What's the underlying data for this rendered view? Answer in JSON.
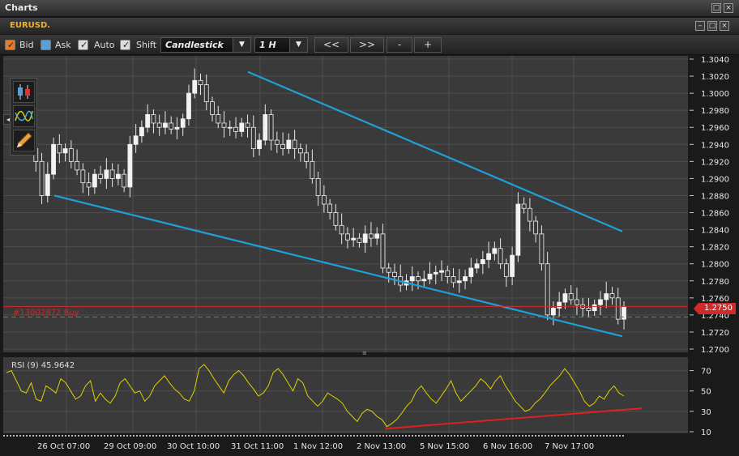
{
  "window": {
    "title": "Charts"
  },
  "chart_window": {
    "title": "EURUSD."
  },
  "toolbar": {
    "bid_label": "Bid",
    "ask_label": "Ask",
    "auto_label": "Auto",
    "shift_label": "Shift",
    "chart_type": "Candlestick",
    "timeframe": "1 H",
    "prev_label": "<<",
    "next_label": ">>",
    "zoom_out_label": "-",
    "zoom_in_label": "+"
  },
  "order_line": {
    "label": "#13002872 Buy",
    "price_badge": "1.2750"
  },
  "rsi": {
    "label": "RSI (9)  45.9642"
  },
  "colors": {
    "trendline": "#1fa0d8",
    "rsi_line": "#e0d000",
    "rsi_trend": "#e02020",
    "order_line": "#d22a2a"
  },
  "icons": [
    "checkbox-icon",
    "candlestick-tool-icon",
    "indicator-tool-icon",
    "pencil-tool-icon",
    "collapse-arrow-icon"
  ],
  "chart_data": [
    {
      "type": "candlestick",
      "title": "EURUSD.",
      "y_ticks": [
        "1.3040",
        "1.3020",
        "1.3000",
        "1.2980",
        "1.2960",
        "1.2940",
        "1.2920",
        "1.2900",
        "1.2880",
        "1.2860",
        "1.2840",
        "1.2820",
        "1.2800",
        "1.2780",
        "1.2760",
        "1.2740",
        "1.2720",
        "1.2700"
      ],
      "ylim": [
        1.27,
        1.304
      ],
      "x_labels": [
        "26 Oct 07:00",
        "29 Oct 09:00",
        "30 Oct 10:00",
        "31 Oct 11:00",
        "1 Nov 12:00",
        "2 Nov 13:00",
        "5 Nov 15:00",
        "6 Nov 16:00",
        "7 Nov 17:00"
      ],
      "close_path": [
        1.2945,
        1.2942,
        1.2938,
        1.295,
        1.2935,
        1.292,
        1.288,
        1.2905,
        1.294,
        1.293,
        1.2935,
        1.292,
        1.291,
        1.2895,
        1.289,
        1.2905,
        1.29,
        1.291,
        1.29,
        1.2905,
        1.289,
        1.294,
        1.295,
        1.296,
        1.2975,
        1.2965,
        1.296,
        1.2965,
        1.2958,
        1.296,
        1.297,
        1.3,
        1.3015,
        1.301,
        1.299,
        1.2975,
        1.2965,
        1.296,
        1.296,
        1.2955,
        1.2965,
        1.296,
        1.2935,
        1.2945,
        1.2975,
        1.2945,
        1.294,
        1.2935,
        1.2945,
        1.2935,
        1.293,
        1.292,
        1.29,
        1.288,
        1.287,
        1.286,
        1.2845,
        1.2835,
        1.2828,
        1.283,
        1.2825,
        1.2835,
        1.283,
        1.2835,
        1.2795,
        1.279,
        1.2785,
        1.2775,
        1.278,
        1.2785,
        1.278,
        1.2782,
        1.2788,
        1.279,
        1.2792,
        1.2785,
        1.2778,
        1.278,
        1.2785,
        1.2795,
        1.28,
        1.2805,
        1.2812,
        1.2818,
        1.28,
        1.2785,
        1.281,
        1.287,
        1.2865,
        1.285,
        1.2835,
        1.28,
        1.274,
        1.2748,
        1.2755,
        1.2765,
        1.2758,
        1.2752,
        1.2748,
        1.2745,
        1.2752,
        1.2758,
        1.2765,
        1.276,
        1.2735,
        1.275
      ],
      "lines": [
        {
          "name": "upper-channel",
          "from": [
            "31 Oct 11:00",
            1.3025
          ],
          "to": [
            "7 Nov 17:00",
            1.2838
          ]
        },
        {
          "name": "lower-channel",
          "from": [
            "26 Oct 07:00",
            1.288
          ],
          "to": [
            "7 Nov 17:00",
            1.2715
          ]
        }
      ],
      "horizontal_lines": [
        1.275
      ]
    },
    {
      "type": "line",
      "title": "RSI (9)  45.9642",
      "y_ticks": [
        "70",
        "50",
        "30",
        "10"
      ],
      "ylim": [
        10,
        80
      ],
      "series": [
        {
          "values": [
            68,
            70,
            60,
            50,
            48,
            58,
            42,
            40,
            55,
            52,
            48,
            62,
            58,
            50,
            42,
            45,
            55,
            60,
            40,
            48,
            42,
            38,
            45,
            58,
            62,
            55,
            48,
            50,
            40,
            45,
            55,
            60,
            65,
            58,
            52,
            48,
            42,
            40,
            50,
            72,
            76,
            70,
            62,
            55,
            48,
            60,
            66,
            70,
            65,
            58,
            52,
            45,
            48,
            55,
            68,
            72,
            66,
            58,
            50,
            62,
            58,
            45,
            40,
            35,
            40,
            48,
            45,
            42,
            38,
            30,
            25,
            20,
            28,
            32,
            30,
            25,
            22,
            15,
            18,
            22,
            28,
            35,
            40,
            50,
            55,
            48,
            42,
            38,
            45,
            52,
            60,
            48,
            40,
            45,
            50,
            55,
            62,
            58,
            52,
            60,
            65,
            55,
            48,
            40,
            35,
            30,
            32,
            38,
            42,
            48,
            55,
            60,
            65,
            72,
            66,
            58,
            50,
            40,
            35,
            38,
            45,
            42,
            50,
            55,
            48,
            45
          ]
        }
      ],
      "lines": [
        {
          "name": "rsi-trendline",
          "from": [
            "2 Nov 13:00",
            13
          ],
          "to": [
            "7 Nov 17:00",
            33
          ]
        }
      ]
    }
  ]
}
